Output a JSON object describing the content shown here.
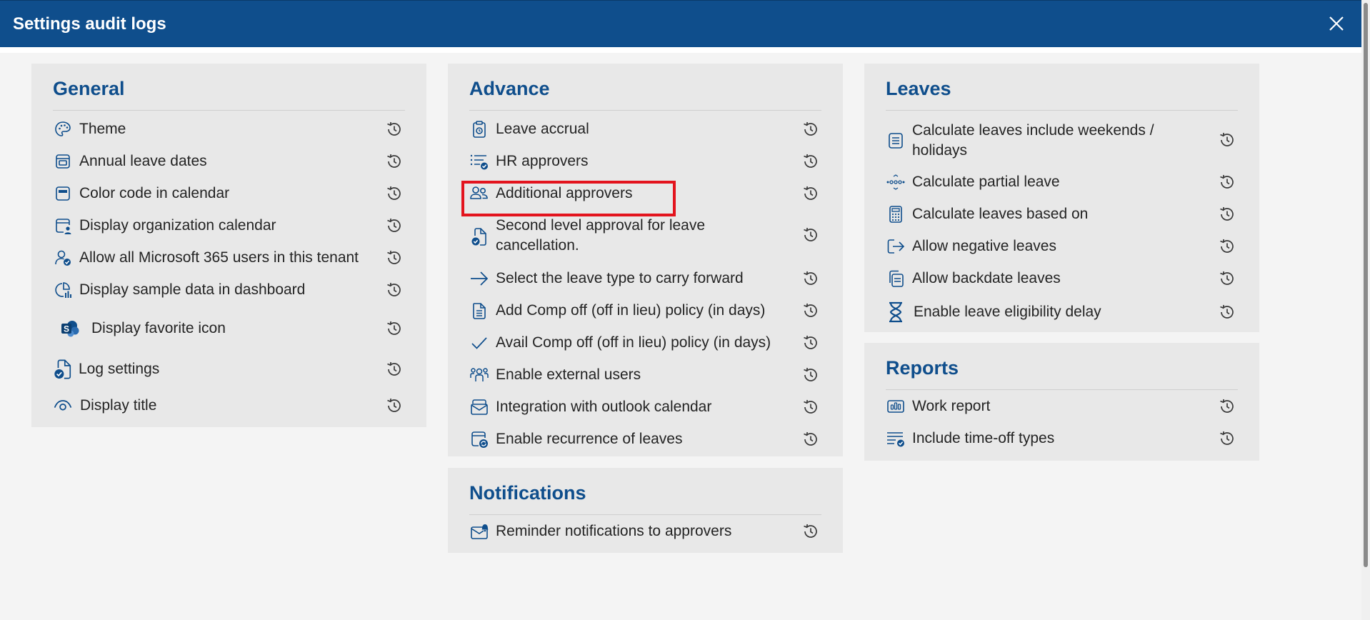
{
  "dialog": {
    "title": "Settings audit logs"
  },
  "colors": {
    "accent": "#0f4e8c",
    "highlight": "#e3141e",
    "card": "#e8e8e8"
  },
  "general": {
    "title": "General",
    "items": [
      {
        "label": "Theme",
        "icon": "palette-icon"
      },
      {
        "label": "Annual leave dates",
        "icon": "calendar-box-icon"
      },
      {
        "label": "Color code in calendar",
        "icon": "calendar-color-icon"
      },
      {
        "label": "Display organization calendar",
        "icon": "calendar-person-icon"
      },
      {
        "label": "Allow all Microsoft 365 users in this tenant",
        "icon": "person-check-icon"
      },
      {
        "label": "Display sample data in dashboard",
        "icon": "chart-icon"
      },
      {
        "label": "Display favorite icon",
        "icon": "sharepoint-icon"
      },
      {
        "label": "Log settings",
        "icon": "document-check-icon"
      },
      {
        "label": "Display title",
        "icon": "eye-icon"
      }
    ]
  },
  "advance": {
    "title": "Advance",
    "items": [
      {
        "label": "Leave accrual",
        "icon": "clipboard-icon"
      },
      {
        "label": "HR approvers",
        "icon": "list-check-icon"
      },
      {
        "label": "Additional approvers",
        "icon": "people-icon"
      },
      {
        "label": "Second level approval for leave",
        "label2": "cancellation.",
        "icon": "document-check-icon"
      },
      {
        "label": "Select the leave type to carry forward",
        "icon": "arrow-right-icon"
      },
      {
        "label": "Add Comp off (off in lieu) policy (in days)",
        "icon": "document-text-icon"
      },
      {
        "label": "Avail Comp off (off in lieu) policy (in days)",
        "icon": "checkmark-icon"
      },
      {
        "label": "Enable external users",
        "icon": "people-team-icon"
      },
      {
        "label": "Integration with outlook calendar",
        "icon": "mail-calendar-icon"
      },
      {
        "label": "Enable recurrence of leaves",
        "icon": "calendar-sync-icon"
      }
    ]
  },
  "notifications": {
    "title": "Notifications",
    "items": [
      {
        "label": "Reminder notifications to approvers",
        "icon": "mail-alert-icon"
      }
    ]
  },
  "leaves": {
    "title": "Leaves",
    "items": [
      {
        "label": "Calculate leaves include weekends /",
        "label2": "holidays",
        "icon": "list-icon"
      },
      {
        "label": "Calculate partial leave",
        "icon": "dots-icon"
      },
      {
        "label": "Calculate leaves based on",
        "icon": "calculator-icon"
      },
      {
        "label": "Allow negative leaves",
        "icon": "sign-out-icon"
      },
      {
        "label": "Allow backdate leaves",
        "icon": "copy-icon"
      },
      {
        "label": "Enable leave eligibility delay",
        "icon": "hourglass-icon"
      }
    ]
  },
  "reports": {
    "title": "Reports",
    "items": [
      {
        "label": "Work report",
        "icon": "bar-chart-icon"
      },
      {
        "label": "Include time-off types",
        "icon": "list-check-icon"
      }
    ]
  }
}
